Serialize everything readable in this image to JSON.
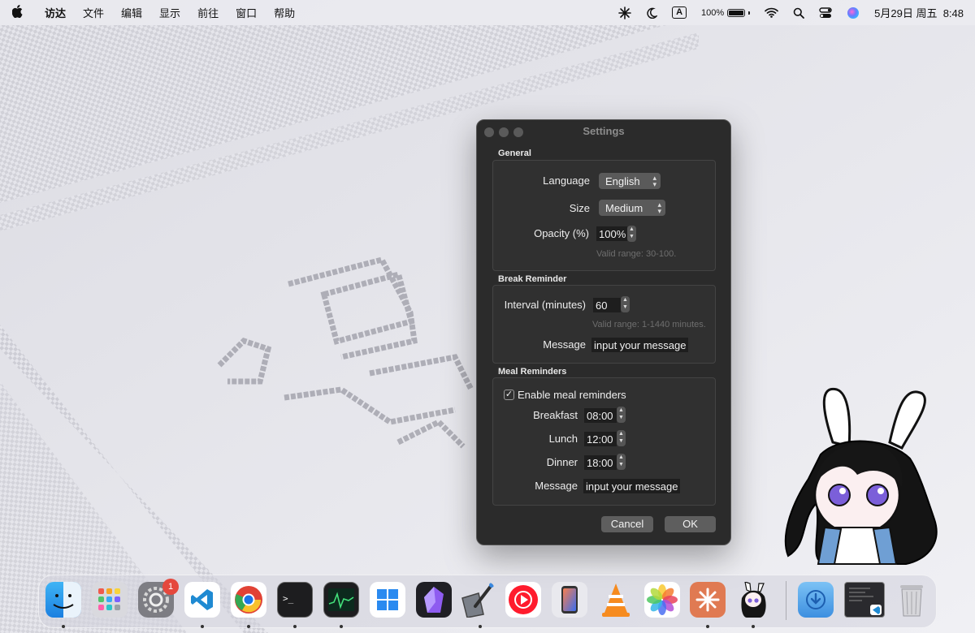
{
  "menubar": {
    "app_name": "访达",
    "menus": [
      "文件",
      "编辑",
      "显示",
      "前往",
      "窗口",
      "帮助"
    ],
    "input_indicator": "A",
    "battery_percent": "100%",
    "datetime": "5月29日 周五  8:48",
    "icons": [
      "apple-logo",
      "asterisk-status",
      "moon",
      "input-source",
      "battery",
      "wifi",
      "spotlight-search",
      "control-center",
      "siri"
    ]
  },
  "settings": {
    "title": "Settings",
    "general": {
      "title": "General",
      "language_label": "Language",
      "language_value": "English",
      "size_label": "Size",
      "size_value": "Medium",
      "opacity_label": "Opacity (%)",
      "opacity_value": "100%",
      "opacity_hint": "Valid range: 30-100."
    },
    "break": {
      "title": "Break Reminder",
      "interval_label": "Interval (minutes)",
      "interval_value": "60",
      "interval_hint": "Valid range: 1-1440 minutes.",
      "message_label": "Message",
      "message_value": "input your message"
    },
    "meal": {
      "title": "Meal Reminders",
      "enable_label": "Enable meal reminders",
      "enable_checked": true,
      "breakfast_label": "Breakfast",
      "breakfast_value": "08:00",
      "lunch_label": "Lunch",
      "lunch_value": "12:00",
      "dinner_label": "Dinner",
      "dinner_value": "18:00",
      "message_label": "Message",
      "message_value": "input your message"
    },
    "buttons": {
      "cancel": "Cancel",
      "ok": "OK"
    }
  },
  "dock": {
    "badge_count": "1",
    "apps": [
      "finder",
      "launchpad",
      "system-settings",
      "vscode",
      "chrome",
      "terminal",
      "activity-monitor",
      "windows-app",
      "obsidian",
      "paintbrush",
      "youtube-music",
      "iphone-mirroring",
      "vlc",
      "photos",
      "claude",
      "desktop-pet"
    ],
    "right_items": [
      "downloads",
      "screen-thumbnail",
      "trash"
    ]
  },
  "colors": {
    "window_bg": "#2b2b2b",
    "badge": "#e5483d",
    "wallpaper": "#e6e6ec"
  }
}
